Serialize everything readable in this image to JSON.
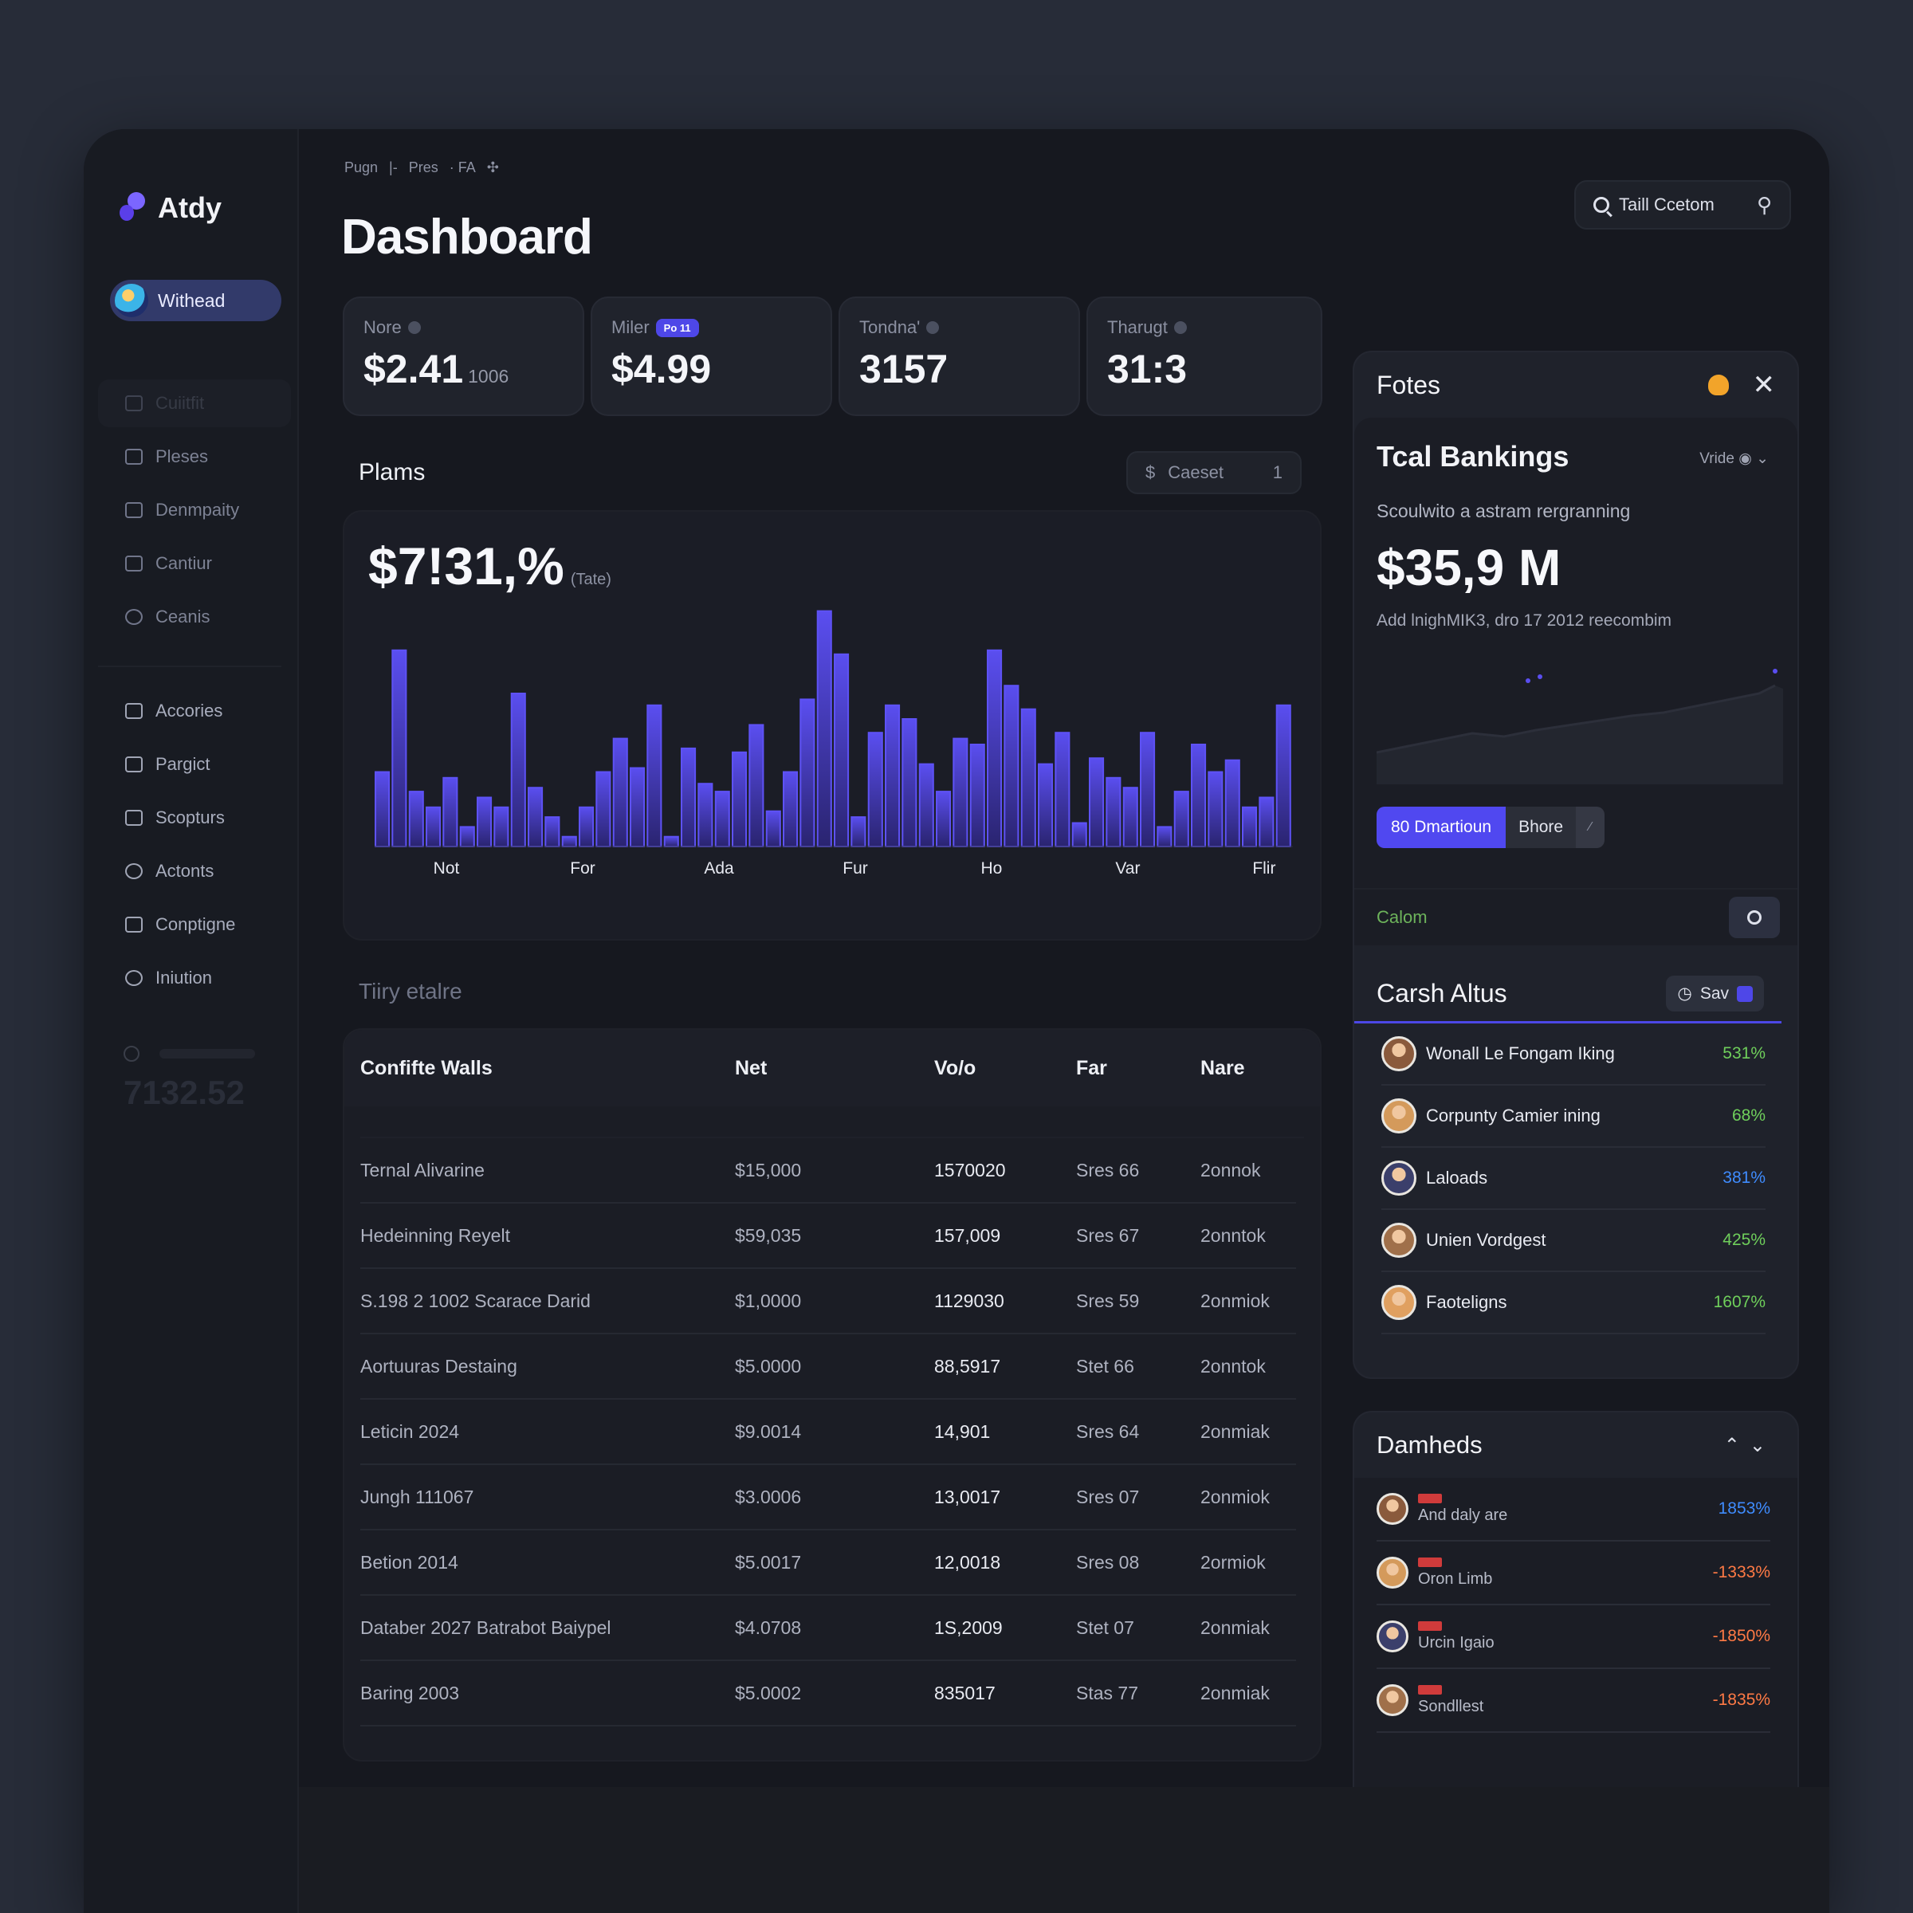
{
  "app": {
    "logo": "Atdy",
    "profile_name": "Withead"
  },
  "sidebar": {
    "items_top": [
      {
        "label": "Cuiitfit",
        "icon": "grid-icon",
        "active": true
      },
      {
        "label": "Pleses",
        "icon": "tools-icon"
      },
      {
        "label": "Denmpaity",
        "icon": "lock-icon"
      },
      {
        "label": "Cantiur",
        "icon": "cup-icon"
      },
      {
        "label": "Ceanis",
        "icon": "refresh-icon"
      }
    ],
    "items_bottom": [
      {
        "label": "Accories",
        "icon": "square-icon"
      },
      {
        "label": "Pargict",
        "icon": "bank-icon"
      },
      {
        "label": "Scopturs",
        "icon": "card-icon"
      },
      {
        "label": "Actonts",
        "icon": "users-icon"
      },
      {
        "label": "Conptigne",
        "icon": "printer-icon"
      },
      {
        "label": "Iniution",
        "icon": "pin-icon"
      }
    ],
    "ghost_value": "7132.52"
  },
  "header": {
    "breadcrumb": [
      "Pugn",
      "|-",
      "Pres",
      "· FA"
    ],
    "title": "Dashboard",
    "search_label": "Taill Ccetom"
  },
  "kpis": [
    {
      "label": "Nore",
      "value": "$2.41",
      "sub": "1006",
      "badge": ""
    },
    {
      "label": "Miler",
      "value": "$4.99",
      "sub": "",
      "badge": "Po 11"
    },
    {
      "label": "Tondna'",
      "value": "3157",
      "sub": "",
      "badge": ""
    },
    {
      "label": "Tharugt",
      "value": "31:3",
      "sub": "",
      "badge": ""
    }
  ],
  "plans": {
    "title": "Plams",
    "filter_label": "Caeset",
    "filter_icon": "$",
    "filter_count": "1",
    "big_value": "$7!31,%",
    "big_sub": "(Tate)"
  },
  "chart_data": {
    "type": "bar",
    "title": "",
    "xlabel": "",
    "ylabel": "",
    "x_tick_labels": [
      "Not",
      "For",
      "Ada",
      "Fur",
      "Ho",
      "Var",
      "Flir"
    ],
    "values": [
      38,
      100,
      28,
      20,
      35,
      10,
      25,
      20,
      78,
      30,
      15,
      5,
      20,
      38,
      55,
      40,
      72,
      5,
      50,
      32,
      28,
      48,
      62,
      18,
      38,
      75,
      120,
      98,
      15,
      58,
      72,
      65,
      42,
      28,
      55,
      52,
      100,
      82,
      70,
      42,
      58,
      12,
      45,
      35,
      30,
      58,
      10,
      28,
      52,
      38,
      44,
      20,
      25,
      72
    ],
    "ylim": [
      0,
      130
    ],
    "colors": {
      "bar": "#4a3fd0",
      "bar_highlight": "#5a4ef0",
      "background": "#1b1d26"
    }
  },
  "table": {
    "ghost_title": "Tiiry etalre",
    "columns": [
      "Confifte Walls",
      "Net",
      "Vo/o",
      "Far",
      "Nare"
    ],
    "rows": [
      [
        "Ternal Alivarine",
        "$15,000",
        "1570020",
        "Sres 66",
        "2onnok"
      ],
      [
        "Hedeinning Reyelt",
        "$59,035",
        "157,009",
        "Sres 67",
        "2onntok"
      ],
      [
        "S.198 2 1002 Scarace Darid",
        "$1,0000",
        "1129030",
        "Sres 59",
        "2onmiok"
      ],
      [
        "Aortuuras Destaing",
        "$5.0000",
        "88,5917",
        "Stet 66",
        "2onntok"
      ],
      [
        "Leticin 2024",
        "$9.0014",
        "14,901",
        "Sres 64",
        "2onmiak"
      ],
      [
        "Jungh 111067",
        "$3.0006",
        "13,0017",
        "Sres 07",
        "2onmiok"
      ],
      [
        "Betion 2014",
        "$5.0017",
        "12,0018",
        "Sres 08",
        "2ormiok"
      ],
      [
        "Databer 2027 Batrabot Baiypel",
        "$4.0708",
        "1S,2009",
        "Stet 07",
        "2onmiak"
      ],
      [
        "Baring 2003",
        "$5.0002",
        "835017",
        "Stas 77",
        "2onmiak"
      ]
    ]
  },
  "right_panel": {
    "title": "Fotes",
    "bank": {
      "title": "Tcal Bankings",
      "dropdown": "Vride",
      "subtitle": "Scoulwito a astram rergranning",
      "value": "$35,9 M",
      "note": "Add lnighMIK3, dro 17 2012 reecombim"
    },
    "segment": {
      "primary": "80 Dmartioun",
      "secondary": "Bhore"
    },
    "calm_label": "Calom",
    "cash": {
      "title": "Carsh Altus",
      "button_label": "Sav",
      "items": [
        {
          "name": "Wonall Le Fongam Iking",
          "pct": "531%",
          "color": "#6fcf5b"
        },
        {
          "name": "Corpunty Camier ining",
          "pct": "68%",
          "color": "#6fcf5b"
        },
        {
          "name": "Laloads",
          "pct": "381%",
          "color": "#3f8cff"
        },
        {
          "name": "Unien Vordgest",
          "pct": "425%",
          "color": "#6fcf5b"
        },
        {
          "name": "Faoteligns",
          "pct": "1607%",
          "color": "#6fcf5b"
        }
      ]
    }
  },
  "damheds": {
    "title": "Damheds",
    "items": [
      {
        "name": "And daly are",
        "pct": "1853%",
        "color": "#3f8cff"
      },
      {
        "name": "Oron Limb",
        "pct": "-1333%",
        "color": "#ff7a45"
      },
      {
        "name": "Urcin Igaio",
        "pct": "-1850%",
        "color": "#ff7a45"
      },
      {
        "name": "Sondllest",
        "pct": "-1835%",
        "color": "#ff7a45"
      }
    ]
  }
}
